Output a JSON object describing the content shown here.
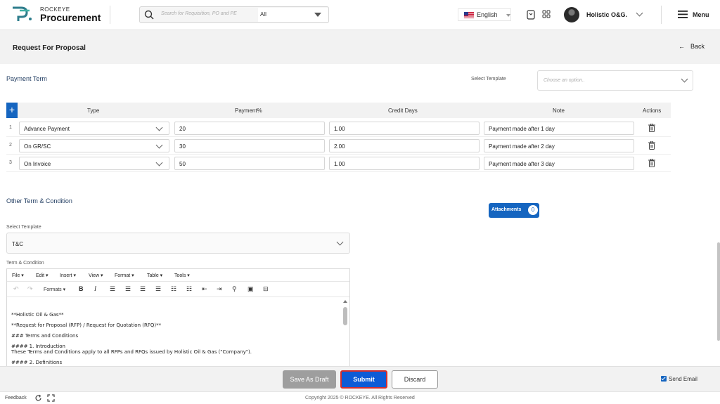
{
  "header": {
    "brand_top": "ROCKEYE",
    "brand_main": "Procurement",
    "search_placeholder": "Search for Requisition, PO and PE",
    "search_scope": "All",
    "language": "English",
    "user_name": "Holistic O&G.",
    "menu_label": "Menu"
  },
  "page": {
    "title": "Request For Proposal",
    "back_label": "Back"
  },
  "payment_term": {
    "title": "Payment Term",
    "select_template_label": "Select Template",
    "select_template_placeholder": "Choose an option..",
    "add_icon": "+",
    "columns": [
      "Type",
      "Payment%",
      "Credit Days",
      "Note",
      "Actions"
    ],
    "rows": [
      {
        "num": "1",
        "type": "Advance Payment",
        "payment": "20",
        "credit_days": "1.00",
        "note": "Payment made after 1 day"
      },
      {
        "num": "2",
        "type": "On GR/SC",
        "payment": "30",
        "credit_days": "2.00",
        "note": "Payment made after 2 day"
      },
      {
        "num": "3",
        "type": "On Invoice",
        "payment": "50",
        "credit_days": "1.00",
        "note": "Payment made after 3 day"
      }
    ]
  },
  "other_terms": {
    "title": "Other Term & Condition",
    "attachments_label": "Attachments",
    "attachments_count": "0",
    "select_template_label": "Select Template",
    "select_template_value": "T&C",
    "term_label": "Term & Condition",
    "editor_menu": [
      "File",
      "Edit",
      "Insert",
      "View",
      "Format",
      "Table",
      "Tools"
    ],
    "formats_label": "Formats",
    "editor_lines": [
      "**Holistic Oil & Gas**",
      "**Request for Proposal (RFP) / Request for Quotation (RFQ)**",
      "### Terms and Conditions",
      "#### 1. Introduction",
      "These Terms and Conditions apply to all RFPs and RFQs issued by Holistic Oil & Gas (\"Company\").",
      "#### 2. Definitions"
    ]
  },
  "actions": {
    "save_draft": "Save As Draft",
    "submit": "Submit",
    "discard": "Discard",
    "send_email": "Send Email"
  },
  "footer": {
    "feedback": "Feedback",
    "copyright": "Copyright 2025 © ROCKEYE. All Rights Reserved"
  },
  "colors": {
    "primary": "#1565c0",
    "submit": "#0d5bd6",
    "submit_border": "#d32f2f",
    "draft": "#9e9e9e"
  }
}
